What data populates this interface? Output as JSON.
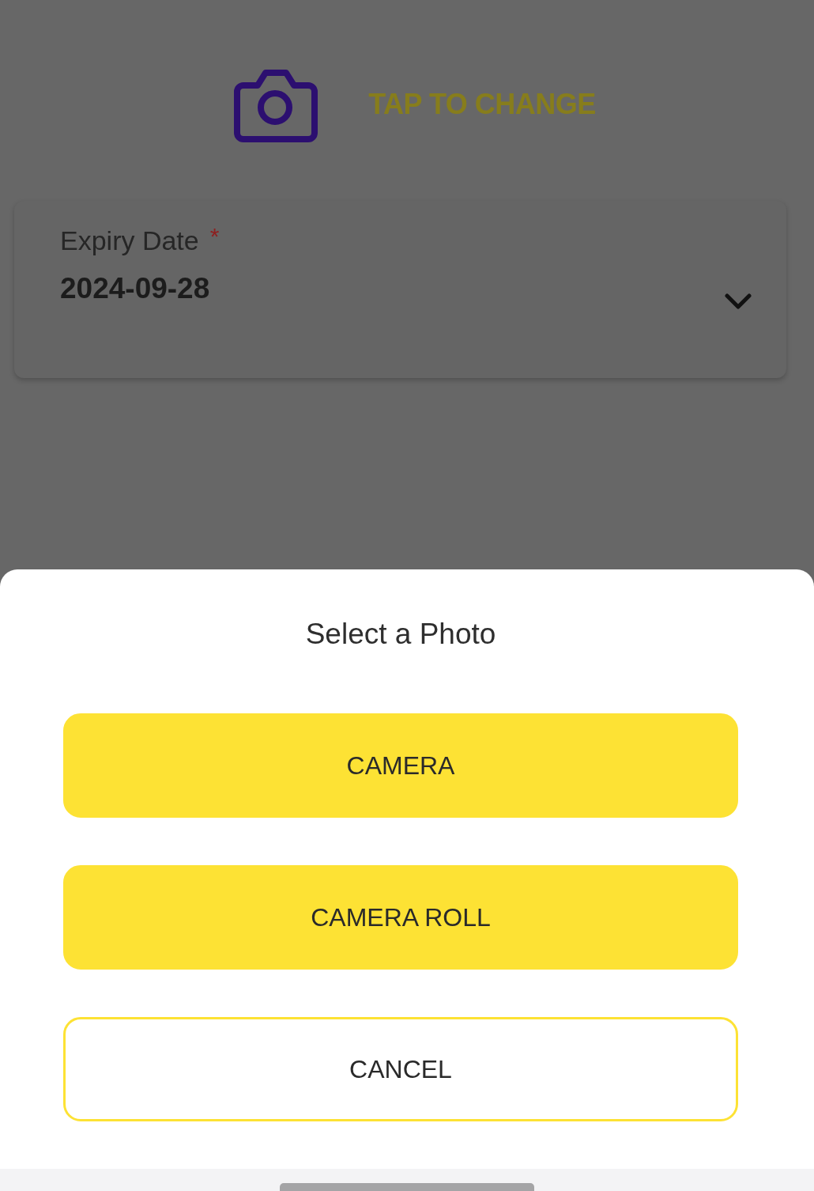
{
  "photo_picker": {
    "label": "TAP TO CHANGE"
  },
  "expiry_field": {
    "label": "Expiry Date",
    "required_mark": "*",
    "value": "2024-09-28"
  },
  "sheet": {
    "title": "Select a Photo",
    "buttons": [
      {
        "label": "CAMERA",
        "kind": "filled"
      },
      {
        "label": "CAMERA ROLL",
        "kind": "filled"
      },
      {
        "label": "CANCEL",
        "kind": "outline"
      }
    ]
  }
}
